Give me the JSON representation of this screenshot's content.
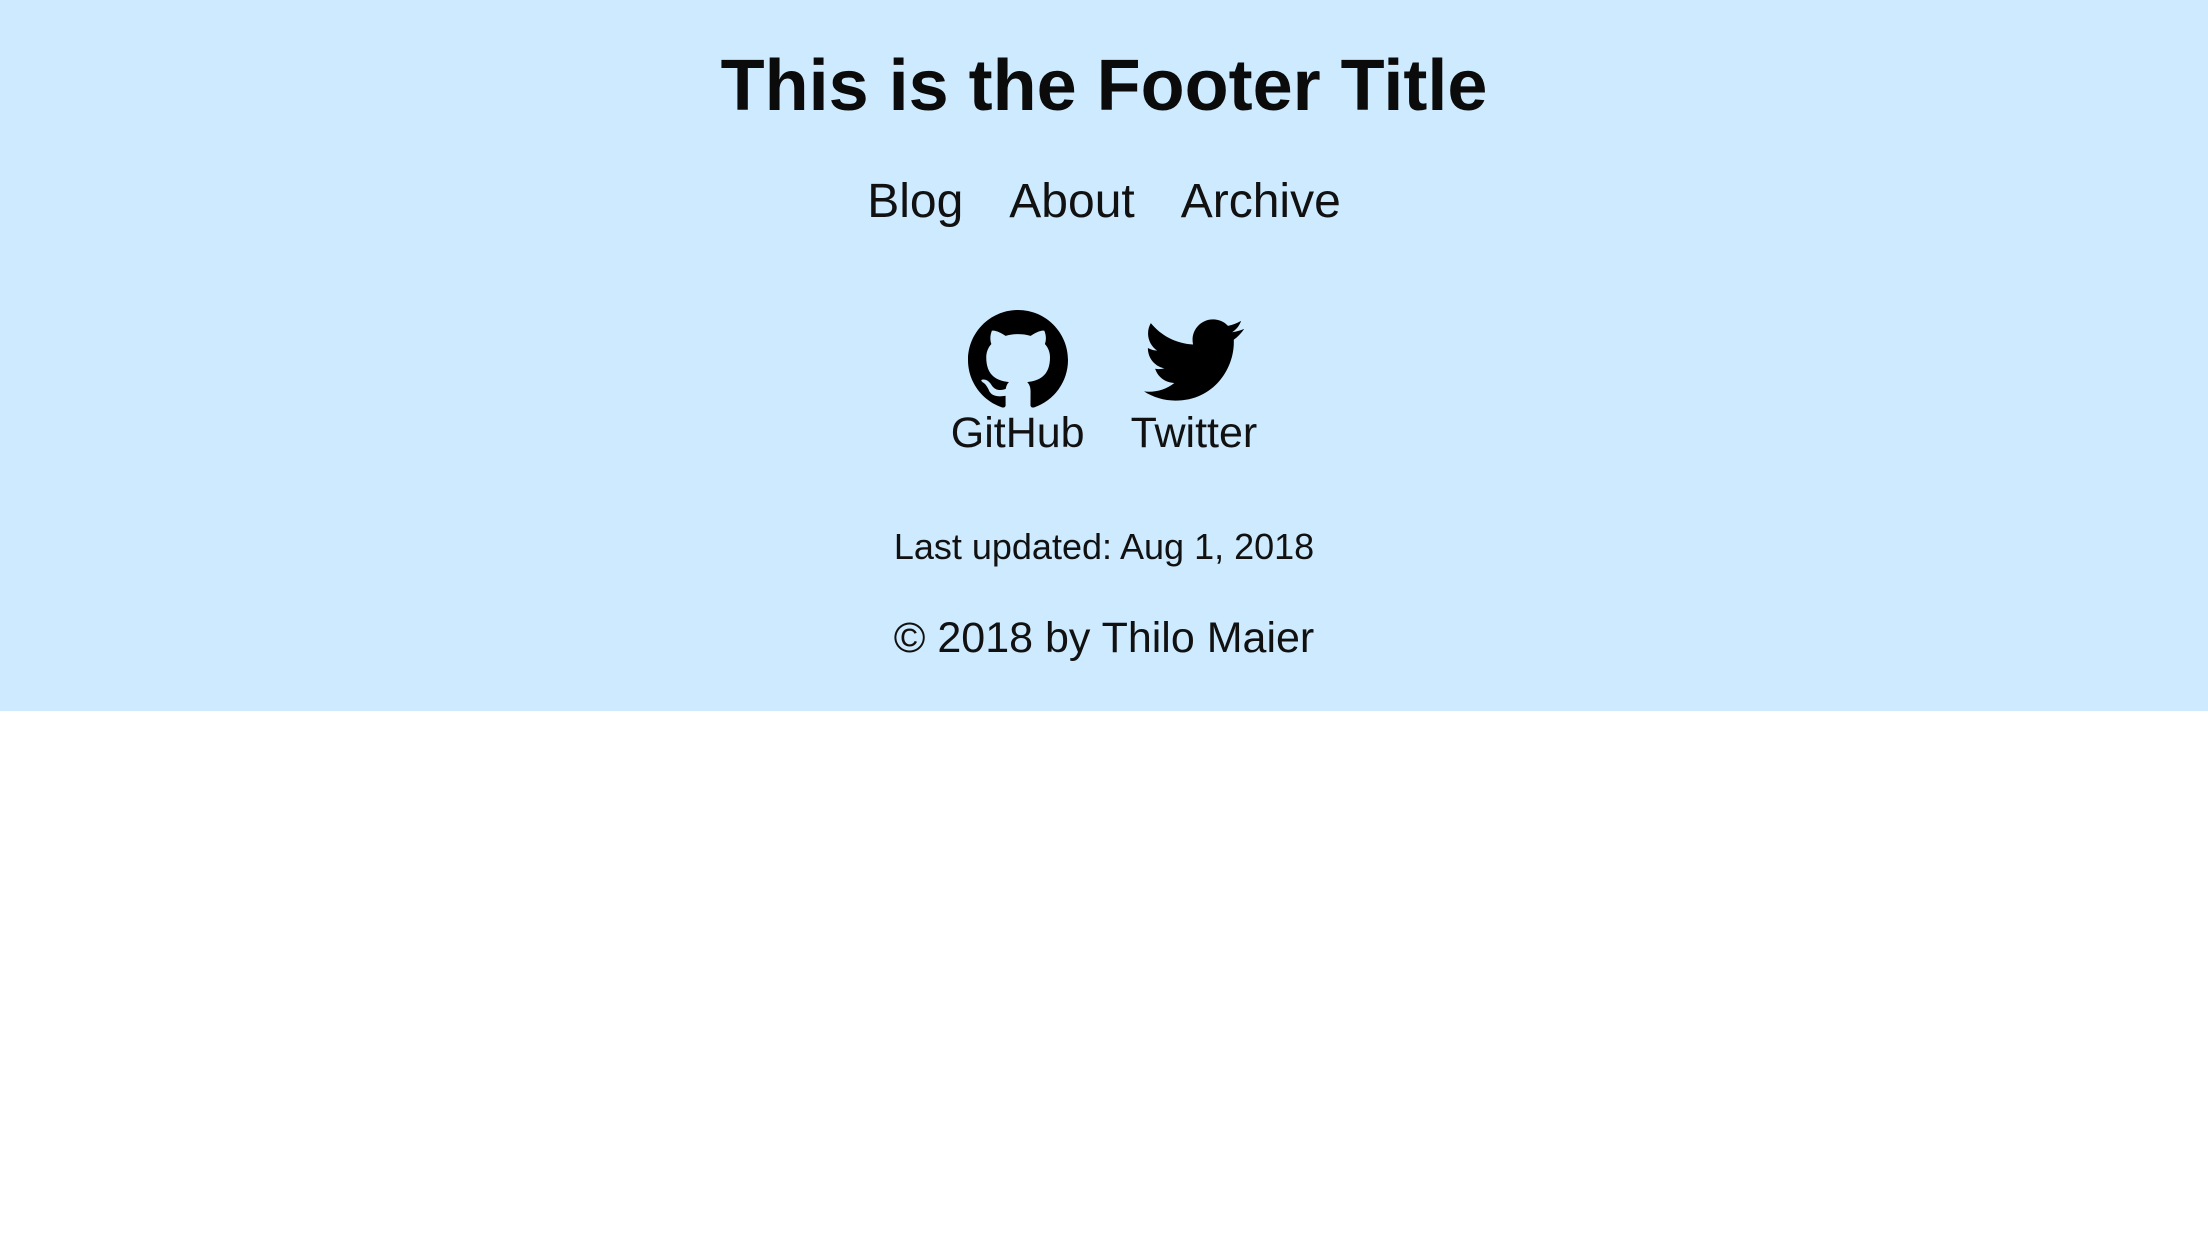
{
  "footer": {
    "title": "This is the Footer Title",
    "nav": [
      {
        "label": "Blog"
      },
      {
        "label": "About"
      },
      {
        "label": "Archive"
      }
    ],
    "social": [
      {
        "label": "GitHub",
        "icon": "github-icon"
      },
      {
        "label": "Twitter",
        "icon": "twitter-icon"
      }
    ],
    "last_updated": "Last updated: Aug 1, 2018",
    "copyright": "© 2018 by Thilo Maier",
    "background_color": "#cdeafe"
  }
}
